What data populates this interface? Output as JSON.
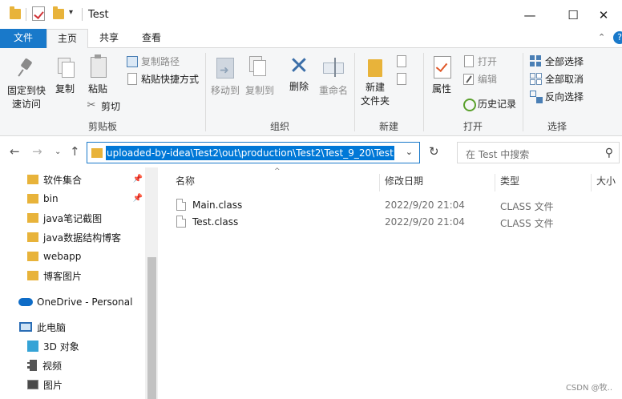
{
  "window": {
    "title": "Test",
    "minimize": "—",
    "maximize": "☐",
    "close": "✕",
    "qat_dropdown": "▾"
  },
  "ribbon_tabs": {
    "file": "文件",
    "home": "主页",
    "share": "共享",
    "view": "查看",
    "collapse": "⌃",
    "help": "?"
  },
  "clipboard": {
    "pin": "固定到快\n速访问",
    "copy": "复制",
    "paste": "粘贴",
    "copy_path": "复制路径",
    "paste_shortcut": "粘贴快捷方式",
    "cut": "剪切",
    "label": "剪贴板"
  },
  "organize": {
    "move_to": "移动到",
    "copy_to": "复制到",
    "delete": "删除",
    "rename": "重命名",
    "label": "组织"
  },
  "new_group": {
    "new_folder": "新建\n文件夹",
    "label": "新建"
  },
  "open_group": {
    "properties": "属性",
    "open": "打开",
    "edit": "编辑",
    "history": "历史记录",
    "label": "打开"
  },
  "select_group": {
    "select_all": "全部选择",
    "select_none": "全部取消",
    "invert": "反向选择",
    "label": "选择"
  },
  "address": {
    "path": "uploaded-by-idea\\Test2\\out\\production\\Test2\\Test_9_20\\Test",
    "search_placeholder": "在 Test 中搜索"
  },
  "nav": {
    "items": [
      {
        "label": "软件集合",
        "pinned": true
      },
      {
        "label": "bin",
        "pinned": true
      },
      {
        "label": "java笔记截图"
      },
      {
        "label": "java数据结构博客"
      },
      {
        "label": "webapp"
      },
      {
        "label": "博客图片"
      }
    ],
    "onedrive": "OneDrive - Personal",
    "this_pc": "此电脑",
    "objects3d": "3D 对象",
    "videos": "视频",
    "pictures": "图片"
  },
  "columns": {
    "name": "名称",
    "modified": "修改日期",
    "type": "类型",
    "size": "大小"
  },
  "files": [
    {
      "name": "Main.class",
      "modified": "2022/9/20 21:04",
      "type": "CLASS 文件"
    },
    {
      "name": "Test.class",
      "modified": "2022/9/20 21:04",
      "type": "CLASS 文件"
    }
  ],
  "watermark": "CSDN @牧.."
}
